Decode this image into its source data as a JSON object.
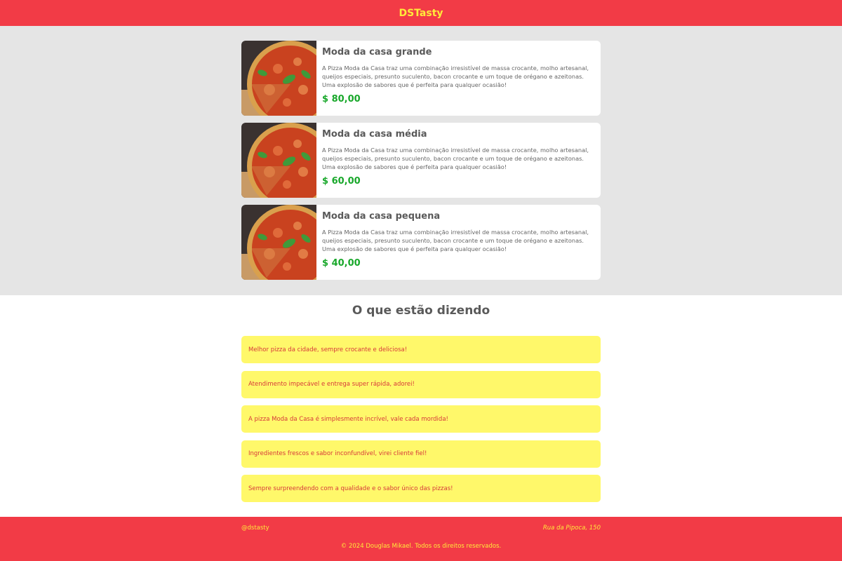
{
  "header": {
    "brand": "DSTasty"
  },
  "menu": {
    "items": [
      {
        "title": "Moda da casa grande",
        "description": "A Pizza Moda da Casa traz uma combinação irresistível de massa crocante, molho artesanal, queijos especiais, presunto suculento, bacon crocante e um toque de orégano e azeitonas. Uma explosão de sabores que é perfeita para qualquer ocasião!",
        "price": "$ 80,00"
      },
      {
        "title": "Moda da casa média",
        "description": "A Pizza Moda da Casa traz uma combinação irresistível de massa crocante, molho artesanal, queijos especiais, presunto suculento, bacon crocante e um toque de orégano e azeitonas. Uma explosão de sabores que é perfeita para qualquer ocasião!",
        "price": "$ 60,00"
      },
      {
        "title": "Moda da casa pequena",
        "description": "A Pizza Moda da Casa traz uma combinação irresistível de massa crocante, molho artesanal, queijos especiais, presunto suculento, bacon crocante e um toque de orégano e azeitonas. Uma explosão de sabores que é perfeita para qualquer ocasião!",
        "price": "$ 40,00"
      }
    ]
  },
  "testimonials": {
    "title": "O que estão dizendo",
    "items": [
      "Melhor pizza da cidade, sempre crocante e deliciosa!",
      "Atendimento impecável e entrega super rápida, adorei!",
      "A pizza Moda da Casa é simplesmente incrível, vale cada mordida!",
      "Ingredientes frescos e sabor inconfundível, virei cliente fiel!",
      "Sempre surpreendendo com a qualidade e o sabor único das pizzas!"
    ]
  },
  "footer": {
    "handle": "@dstasty",
    "address": "Rua da Pipoca, 150",
    "copyright": "© 2024 Douglas Mikael. Todos os direitos reservados."
  },
  "colors": {
    "header_bg": "#f23b46",
    "brand_text": "#ffea3a",
    "price": "#19a82b",
    "testimonial_bg": "#fff86a",
    "testimonial_text": "#d6383a"
  }
}
